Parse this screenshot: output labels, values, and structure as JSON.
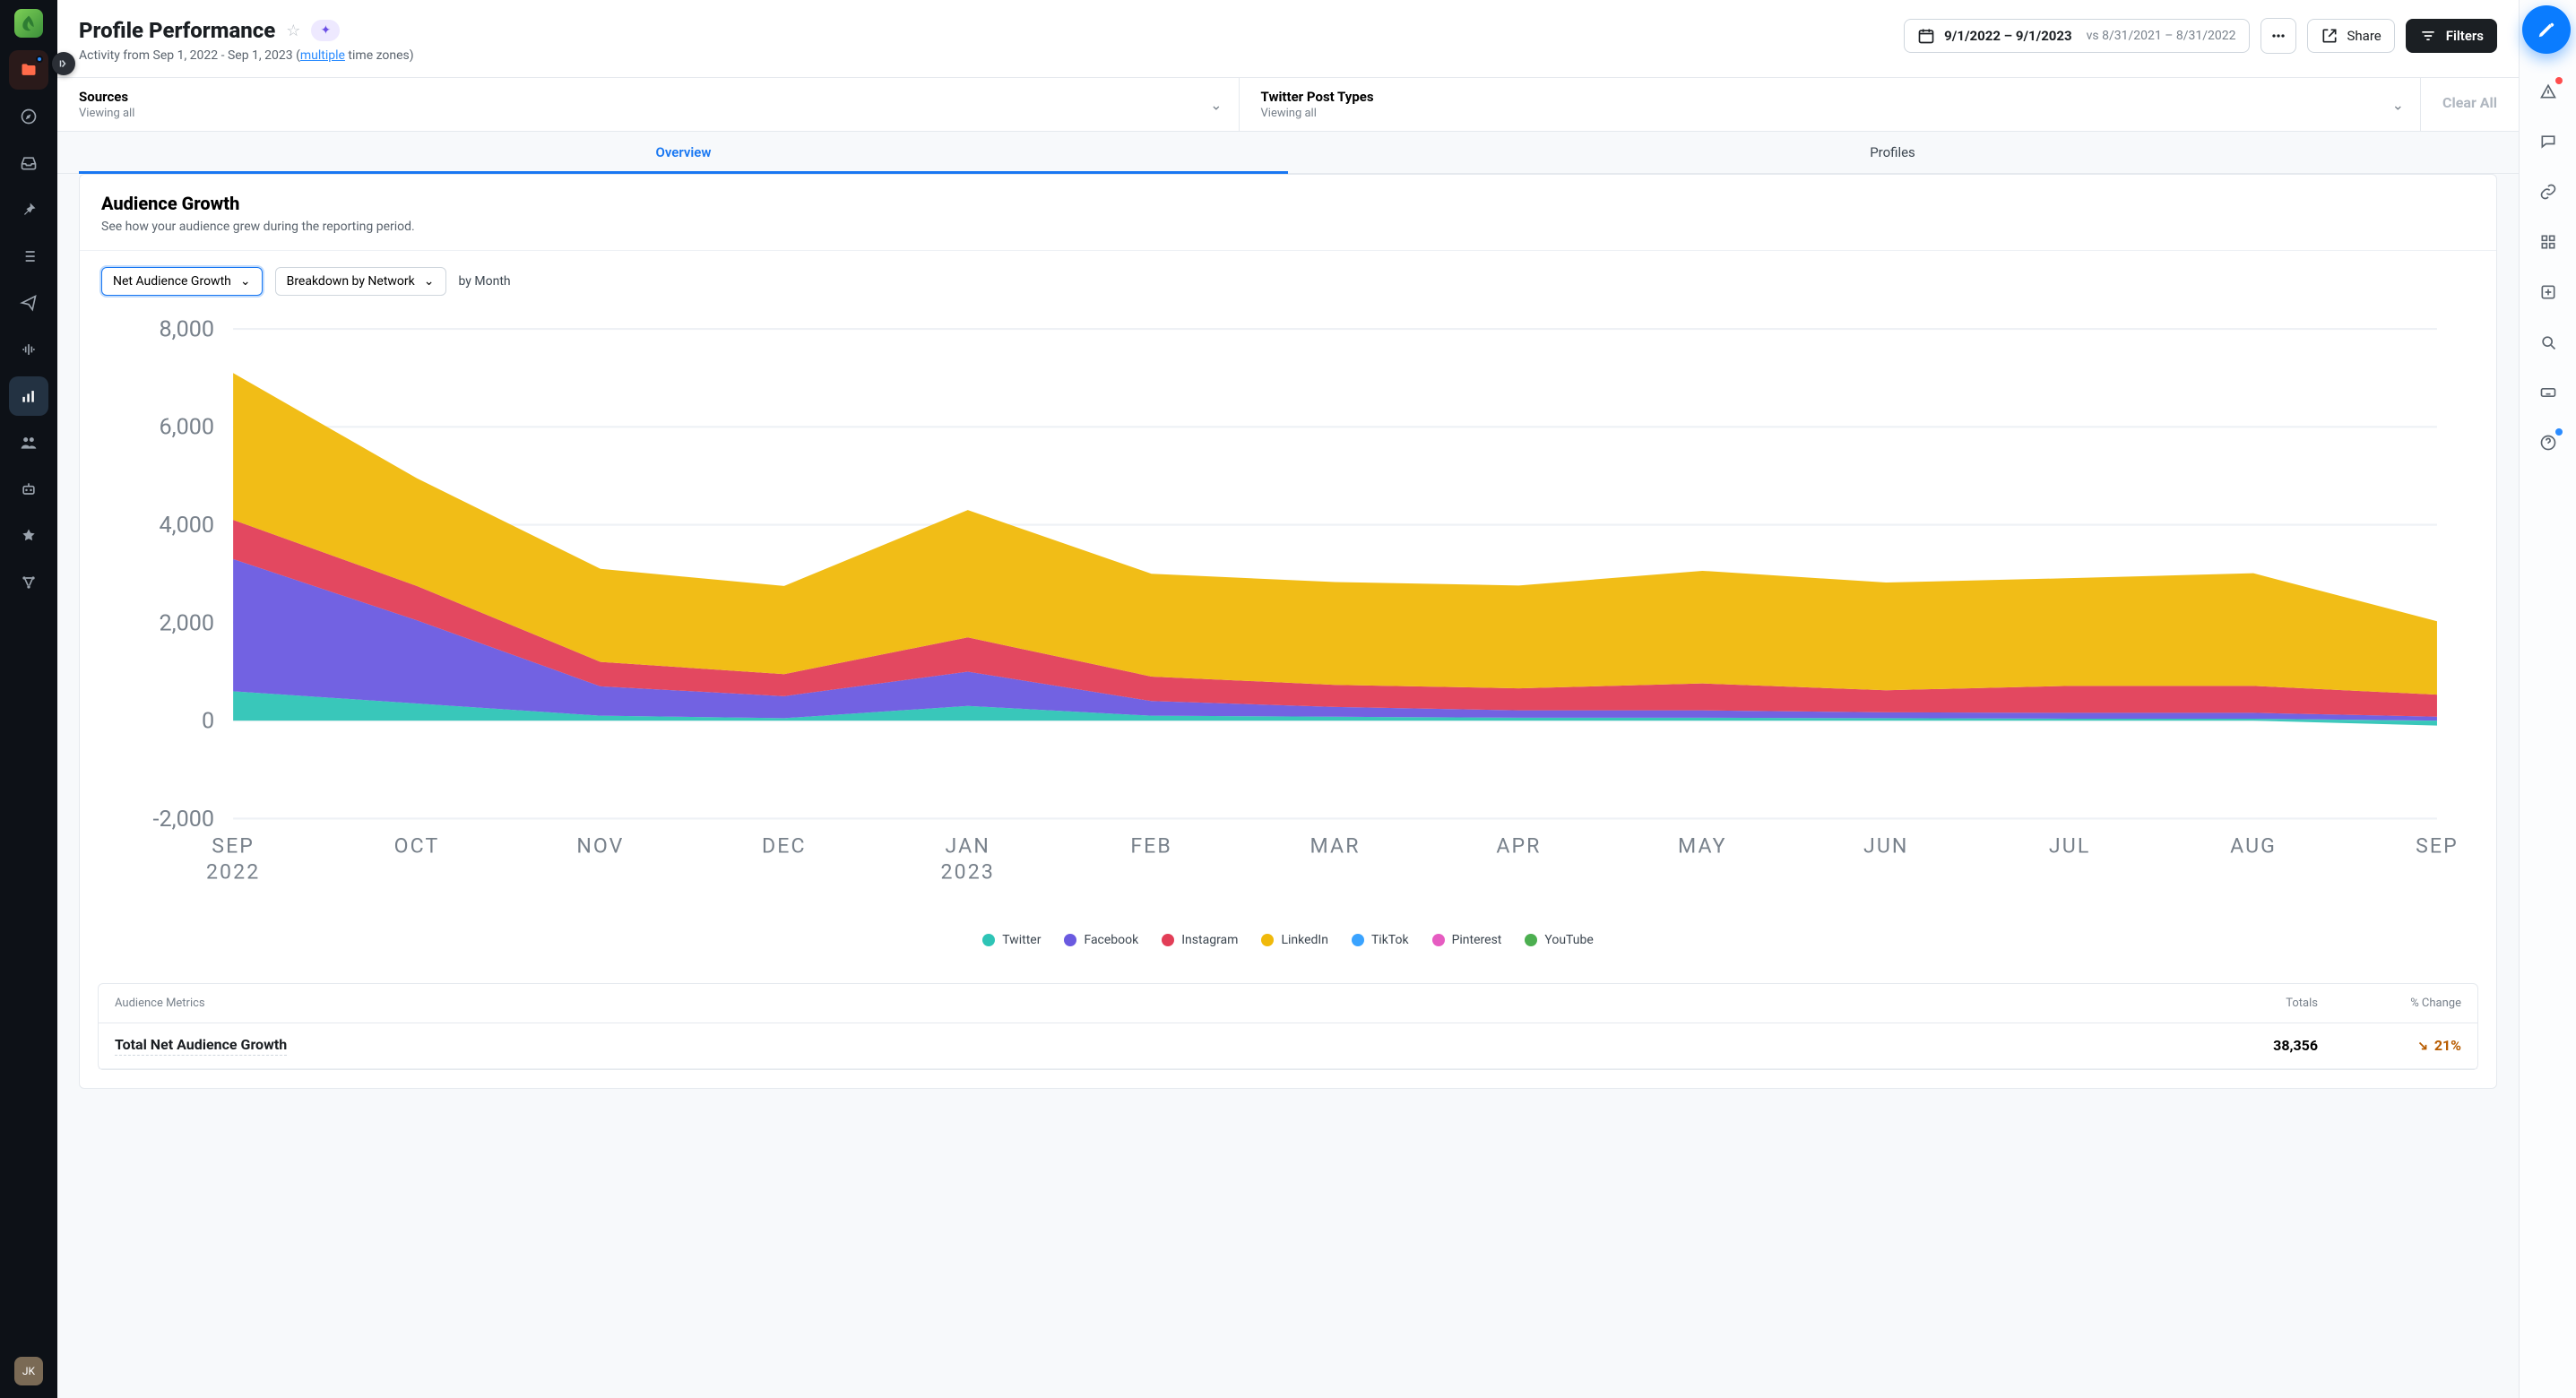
{
  "header": {
    "title": "Profile Performance",
    "ai_badge": "✦",
    "subline_prefix": "Activity from Sep 1, 2022 - Sep 1, 2023 (",
    "subline_link": "multiple",
    "subline_suffix": " time zones)",
    "date_range": "9/1/2022 – 9/1/2023",
    "date_compare": "vs 8/31/2021 – 8/31/2022",
    "share_label": "Share",
    "filters_label": "Filters"
  },
  "filters": {
    "cells": [
      {
        "label": "Sources",
        "sub": "Viewing all"
      },
      {
        "label": "Twitter Post Types",
        "sub": "Viewing all"
      }
    ],
    "clear_all": "Clear All"
  },
  "tabs": {
    "overview": "Overview",
    "profiles": "Profiles"
  },
  "panel": {
    "title": "Audience Growth",
    "subtitle": "See how your audience grew during the reporting period.",
    "metric_select": "Net Audience Growth",
    "breakdown_select": "Breakdown by Network",
    "granularity": "by Month"
  },
  "legend": [
    {
      "name": "Twitter",
      "color": "#2ec4b6"
    },
    {
      "name": "Facebook",
      "color": "#6a5ae0"
    },
    {
      "name": "Instagram",
      "color": "#e23e57"
    },
    {
      "name": "LinkedIn",
      "color": "#f0b90b"
    },
    {
      "name": "TikTok",
      "color": "#3aa3ff"
    },
    {
      "name": "Pinterest",
      "color": "#e65cc1"
    },
    {
      "name": "YouTube",
      "color": "#4caf50"
    }
  ],
  "metrics": {
    "headers": {
      "name": "Audience Metrics",
      "totals": "Totals",
      "change": "% Change"
    },
    "row": {
      "name": "Total Net Audience Growth",
      "total": "38,356",
      "change": "21%"
    }
  },
  "avatar": "JK",
  "chart_data": {
    "type": "area",
    "title": "Net Audience Growth — Breakdown by Network",
    "xlabel": "",
    "ylabel": "",
    "ylim": [
      -2000,
      8000
    ],
    "y_ticks": [
      -2000,
      0,
      2000,
      4000,
      6000,
      8000
    ],
    "x_labels": [
      "SEP 2022",
      "OCT",
      "NOV",
      "DEC",
      "JAN 2023",
      "FEB",
      "MAR",
      "APR",
      "MAY",
      "JUN",
      "JUL",
      "AUG",
      "SEP"
    ],
    "x": [
      0,
      1,
      2,
      3,
      4,
      5,
      6,
      7,
      8,
      9,
      10,
      11,
      12
    ],
    "series": [
      {
        "name": "Twitter",
        "color": "#2ec4b6",
        "values": [
          600,
          350,
          100,
          50,
          300,
          100,
          80,
          60,
          60,
          50,
          40,
          40,
          -100
        ]
      },
      {
        "name": "Facebook",
        "color": "#6a5ae0",
        "values": [
          2700,
          1700,
          600,
          450,
          700,
          300,
          200,
          150,
          150,
          120,
          120,
          120,
          80
        ]
      },
      {
        "name": "Instagram",
        "color": "#e23e57",
        "values": [
          800,
          700,
          500,
          450,
          700,
          500,
          450,
          450,
          550,
          450,
          550,
          550,
          450
        ]
      },
      {
        "name": "LinkedIn",
        "color": "#f0b90b",
        "values": [
          3000,
          2200,
          1900,
          1800,
          2600,
          2100,
          2100,
          2100,
          2300,
          2200,
          2200,
          2300,
          1500
        ]
      },
      {
        "name": "TikTok",
        "color": "#3aa3ff",
        "values": [
          0,
          0,
          0,
          0,
          0,
          0,
          0,
          0,
          0,
          0,
          0,
          0,
          0
        ]
      },
      {
        "name": "Pinterest",
        "color": "#e65cc1",
        "values": [
          0,
          0,
          0,
          0,
          0,
          0,
          0,
          0,
          0,
          0,
          0,
          0,
          0
        ]
      },
      {
        "name": "YouTube",
        "color": "#4caf50",
        "values": [
          0,
          0,
          0,
          0,
          0,
          0,
          0,
          0,
          0,
          0,
          0,
          0,
          0
        ]
      }
    ]
  }
}
